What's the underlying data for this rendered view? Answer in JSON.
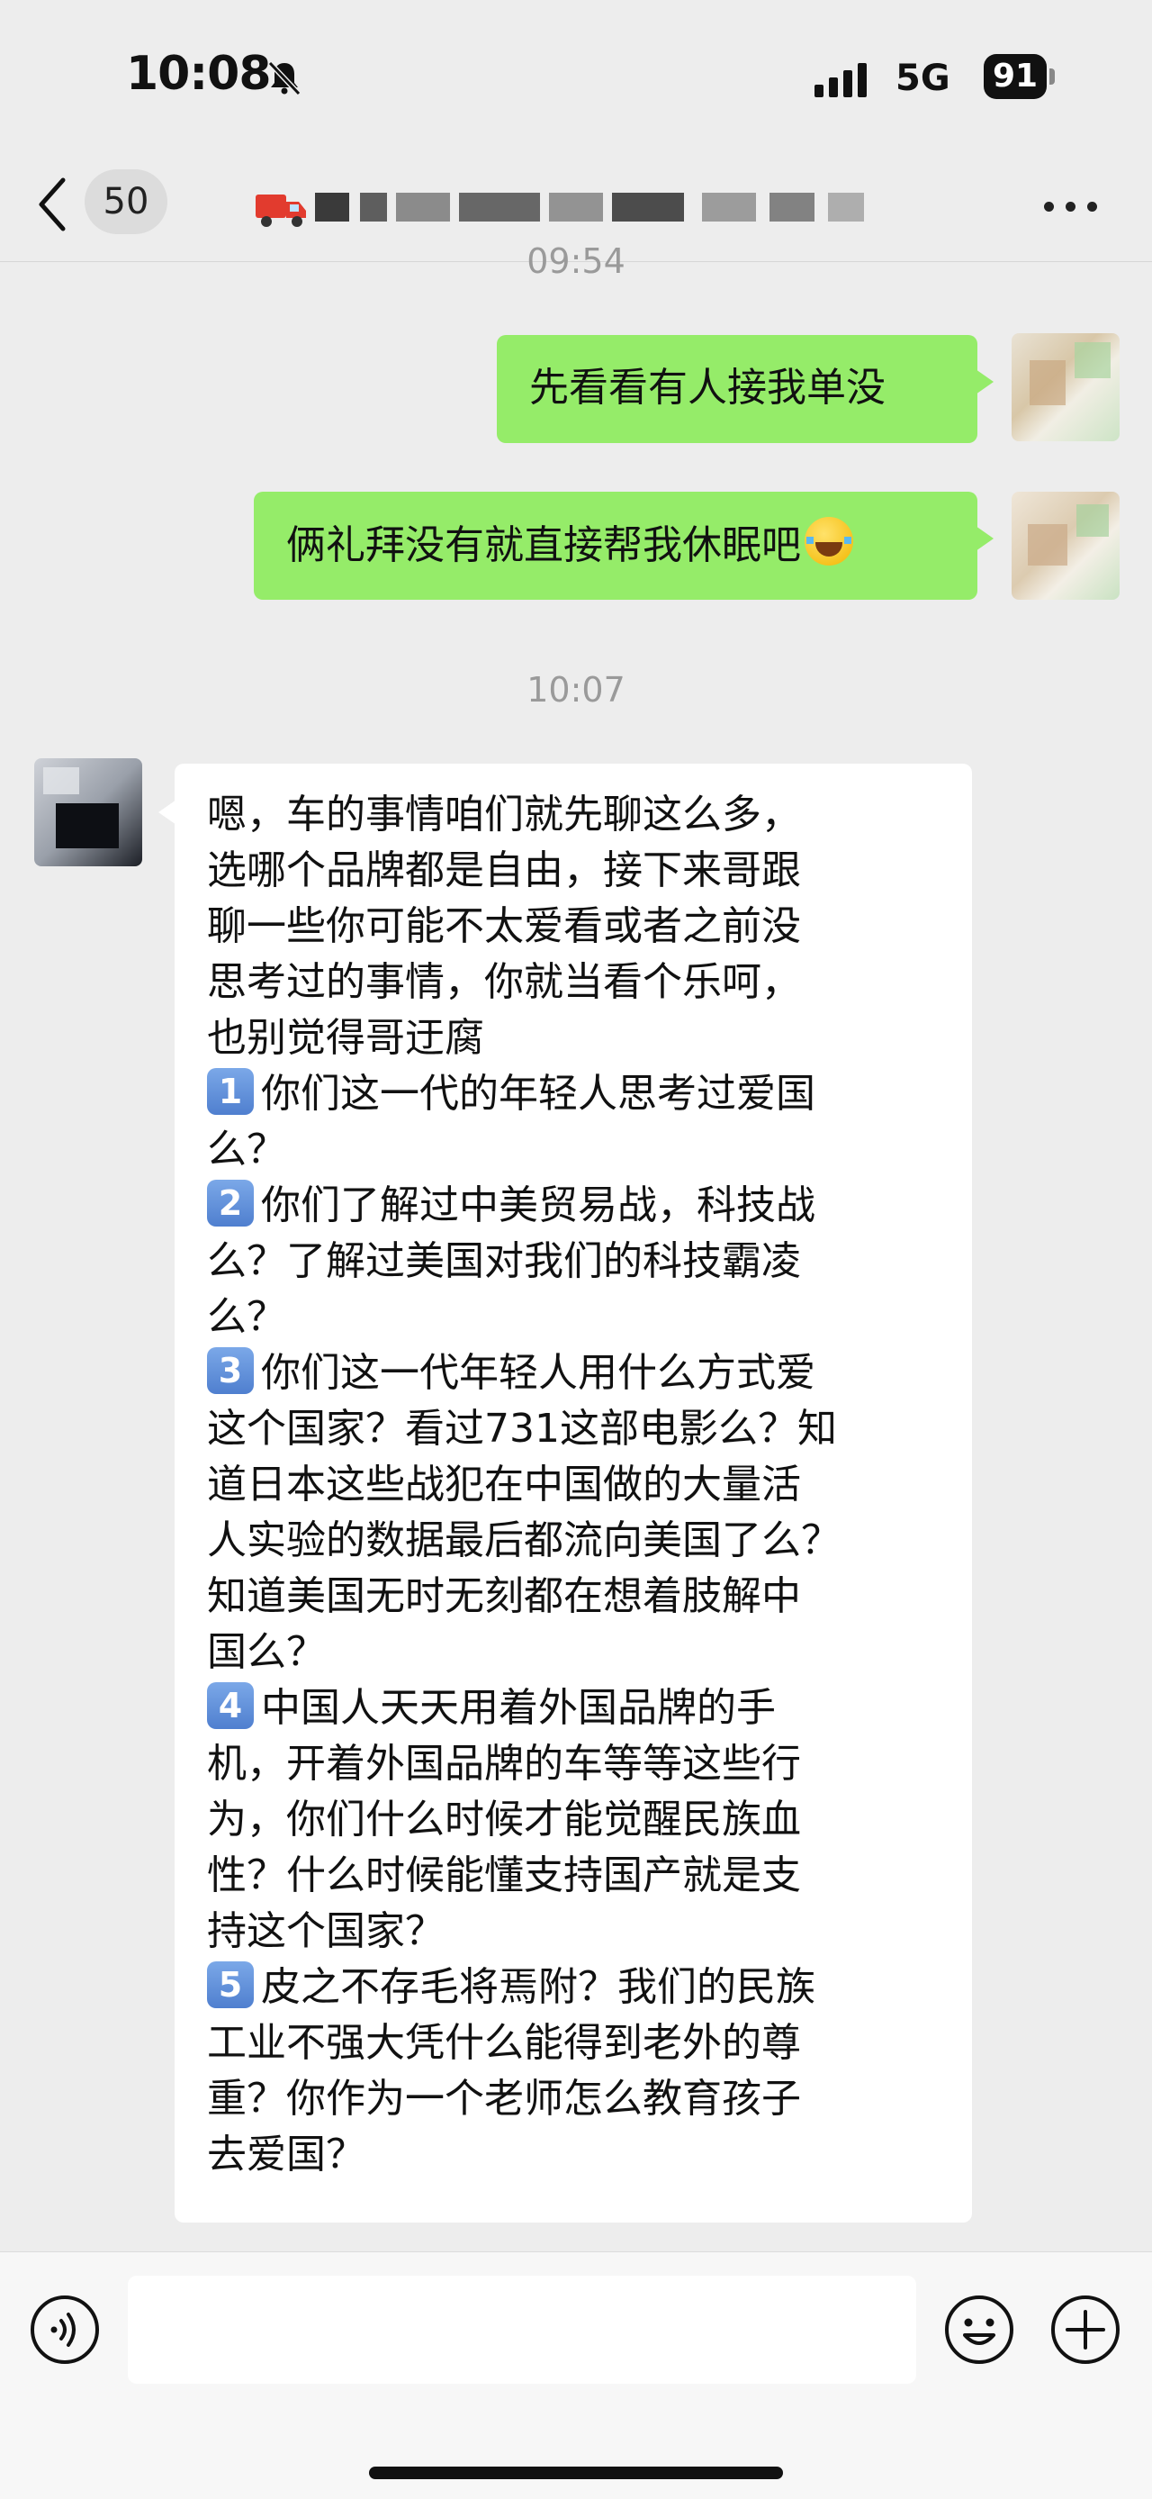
{
  "status_bar": {
    "time": "10:08",
    "network": "5G",
    "battery": "91"
  },
  "nav": {
    "unread_count": "50"
  },
  "messages": {
    "timestamp_top": "09:54",
    "sent_1": "先看看有人接我单没",
    "sent_2": "俩礼拜没有就直接帮我休眠吧",
    "timestamp_mid": "10:07",
    "received": {
      "intro": [
        "嗯，车的事情咱们就先聊这么多，",
        "选哪个品牌都是自由，接下来哥跟",
        "聊一些你可能不太爱看或者之前没",
        "思考过的事情，你就当看个乐呵，",
        "也别觉得哥迂腐"
      ],
      "q1_num": "1",
      "q1": [
        "你们这一代的年轻人思考过爱国",
        "么？"
      ],
      "q2_num": "2",
      "q2": [
        "你们了解过中美贸易战，科技战",
        "么？了解过美国对我们的科技霸凌",
        "么？"
      ],
      "q3_num": "3",
      "q3": [
        "你们这一代年轻人用什么方式爱",
        "这个国家？看过731这部电影么？知",
        "道日本这些战犯在中国做的大量活",
        "人实验的数据最后都流向美国了么？",
        "知道美国无时无刻都在想着肢解中",
        "国么？"
      ],
      "q4_num": "4",
      "q4": [
        "中国人天天用着外国品牌的手",
        "机，开着外国品牌的车等等这些行",
        "为，你们什么时候才能觉醒民族血",
        "性？什么时候能懂支持国产就是支",
        "持这个国家？"
      ],
      "q5_num": "5",
      "q5": [
        "皮之不存毛将焉附？我们的民族",
        "工业不强大凭什么能得到老外的尊",
        "重？你作为一个老师怎么教育孩子",
        "去爱国？"
      ]
    }
  },
  "icons": {
    "back": "chevron-left-icon",
    "more": "more-dots-icon",
    "voice": "voice-icon",
    "emoji": "emoji-icon",
    "add": "plus-icon"
  },
  "colors": {
    "sent_bubble": "#95ec69",
    "received_bubble": "#ffffff",
    "background": "#ededed"
  }
}
